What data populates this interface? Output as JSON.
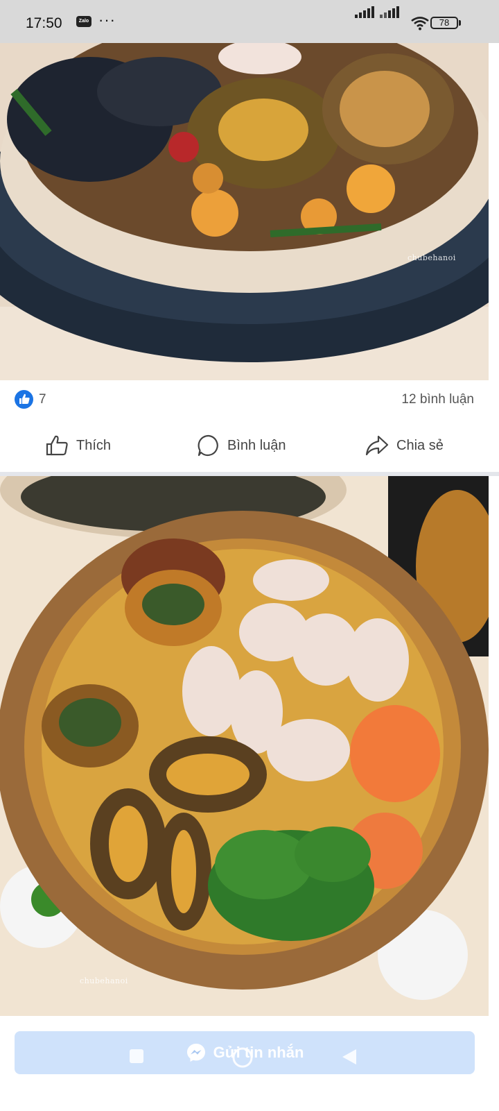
{
  "status_bar": {
    "time": "17:50",
    "notification_app": "Zalo",
    "more_indicator": "···",
    "battery_level": "78",
    "icons": [
      "signal-icon",
      "signal-icon",
      "wifi-icon",
      "battery-icon"
    ]
  },
  "post": {
    "photos": [
      {
        "watermark": "chubehanoi"
      },
      {
        "watermark": "chubehanoi"
      }
    ],
    "reactions": {
      "like_count": "7",
      "comment_count": "12 bình luận"
    },
    "actions": {
      "like_label": "Thích",
      "comment_label": "Bình luận",
      "share_label": "Chia sẻ"
    }
  },
  "message_button": {
    "label": "Gửi tin nhắn",
    "icon": "messenger-icon"
  },
  "nav_bar": {
    "icons": [
      "recents-icon",
      "home-icon",
      "back-icon"
    ]
  },
  "colors": {
    "accent": "#1b74e4",
    "status_bar_bg": "#d9d9d9",
    "message_button_bg": "#cfe2fb"
  }
}
